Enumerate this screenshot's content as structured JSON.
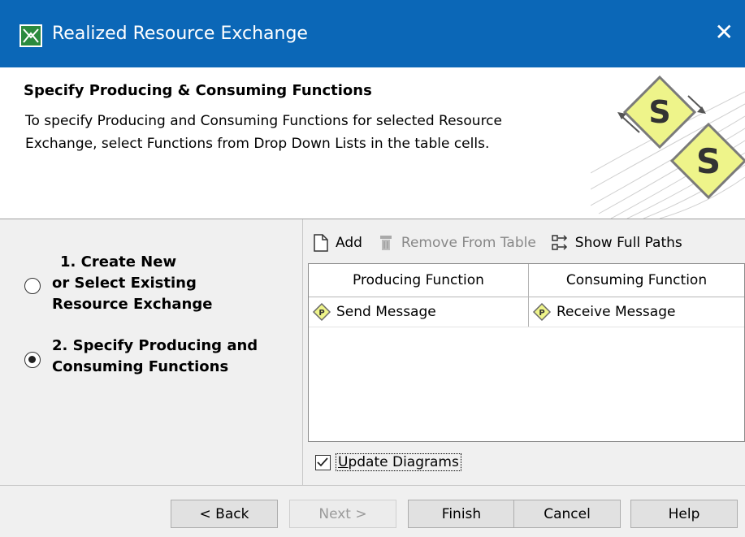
{
  "window": {
    "title": "Realized Resource Exchange",
    "close_symbol": "✕"
  },
  "header": {
    "heading": "Specify Producing & Consuming Functions",
    "description": "To specify Producing and Consuming Functions for selected Resource Exchange, select Functions from Drop Down Lists in the table cells.",
    "logo_letter": "S"
  },
  "steps": [
    {
      "number": "1.",
      "line1": "Create New",
      "line2": "or Select Existing",
      "line3": "Resource Exchange",
      "selected": false
    },
    {
      "number": "2.",
      "line1": "Specify Producing and",
      "line2": "Consuming Functions",
      "selected": true
    }
  ],
  "toolbar": {
    "add": "Add",
    "remove": "Remove From Table",
    "show_paths": "Show Full Paths"
  },
  "table": {
    "columns": [
      "Producing Function",
      "Consuming Function"
    ],
    "rows": [
      {
        "producing": "Send Message",
        "consuming": "Receive Message",
        "icon_letter": "P"
      }
    ]
  },
  "update_diagrams": {
    "label_u": "U",
    "label_rest": "pdate Diagrams",
    "checked": true
  },
  "buttons": {
    "back": "< Back",
    "next": "Next >",
    "finish": "Finish",
    "cancel": "Cancel",
    "help": "Help"
  },
  "colors": {
    "titlebar": "#0b67b7",
    "logo_fill": "#eef48a",
    "logo_border": "#7a7a7a"
  }
}
